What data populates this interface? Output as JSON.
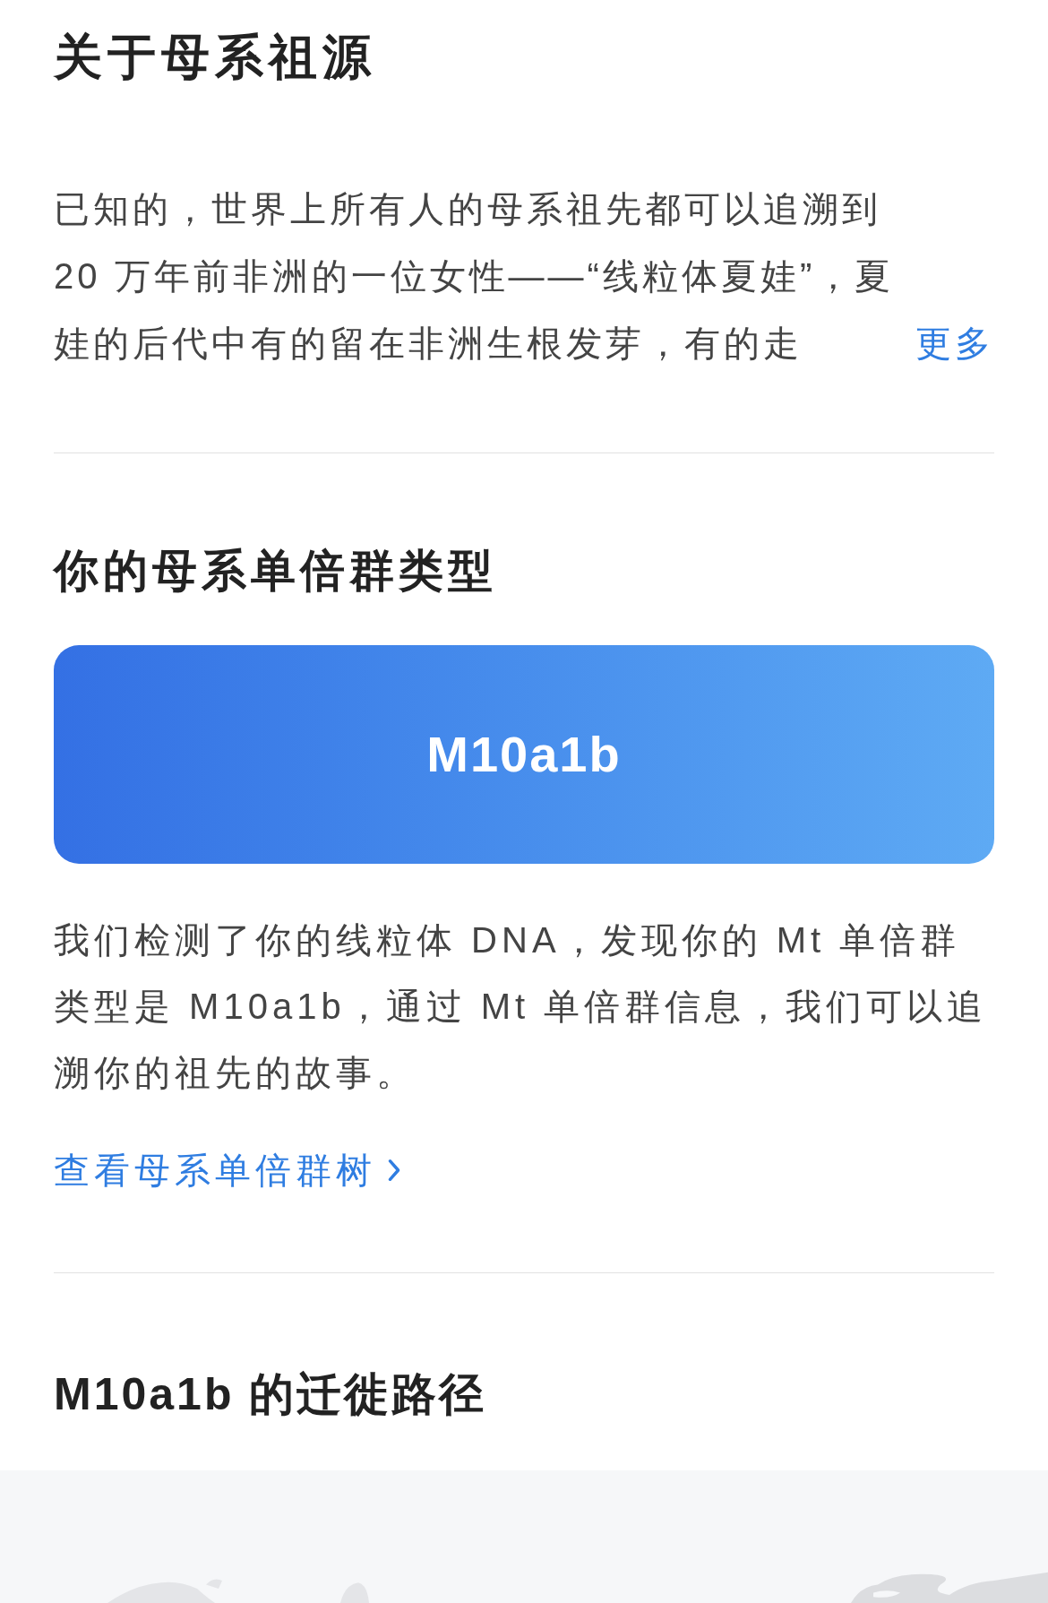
{
  "about": {
    "title": "关于母系祖源",
    "text": "已知的，世界上所有人的母系祖先都可以追溯到 20 万年前非洲的一位女性——“线粒体夏娃”，夏娃的后代中有的留在非洲生根发芽，有的走",
    "more_link": "更多"
  },
  "haplogroup": {
    "title": "你的母系单倍群类型",
    "value": "M10a1b",
    "text": "我们检测了你的线粒体 DNA，发现你的 Mt 单倍群类型是 M10a1b，通过 Mt 单倍群信息，我们可以追溯你的祖先的故事。",
    "tree_link": "查看母系单倍群树"
  },
  "migration": {
    "title": "M10a1b 的迁徙路径"
  }
}
